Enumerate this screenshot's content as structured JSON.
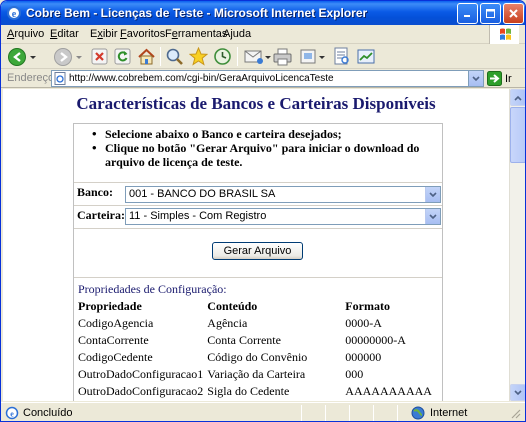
{
  "window": {
    "title": "Cobre Bem - Licenças de Teste - Microsoft Internet Explorer"
  },
  "menu": {
    "items": [
      "Arquivo",
      "Editar",
      "Exibir",
      "Favoritos",
      "Ferramentas",
      "Ajuda"
    ],
    "accels": [
      "A",
      "E",
      "x",
      "F",
      "e",
      "j"
    ]
  },
  "address": {
    "label": "Endereço",
    "url": "http://www.cobrebem.com/cgi-bin/GeraArquivoLicencaTeste",
    "go_label": "Ir"
  },
  "page": {
    "title": "Características de Bancos e Carteiras Disponíveis",
    "instructions": [
      "Selecione abaixo o Banco e carteira desejados;",
      "Clique no botão \"Gerar Arquivo\" para iniciar o download do arquivo de licença de teste."
    ],
    "bank_label": "Banco:",
    "bank_value": "001 - BANCO DO BRASIL SA",
    "wallet_label": "Carteira:",
    "wallet_value": "11 - Simples - Com Registro",
    "generate_button": "Gerar Arquivo",
    "properties_title": "Propriedades de Configuração:",
    "properties_headers": [
      "Propriedade",
      "Conteúdo",
      "Formato"
    ],
    "properties_rows": [
      [
        "CodigoAgencia",
        "Agência",
        "0000-A"
      ],
      [
        "ContaCorrente",
        "Conta Corrente",
        "00000000-A"
      ],
      [
        "CodigoCedente",
        "Código do Convênio",
        "000000"
      ],
      [
        "OutroDadoConfiguracao1",
        "Variação da Carteira",
        "000"
      ],
      [
        "OutroDadoConfiguracao2",
        "Sigla do Cedente",
        "AAAAAAAAAA"
      ]
    ]
  },
  "status": {
    "left": "Concluído",
    "zone": "Internet"
  },
  "colors": {
    "title_bar": "#0A5AE6",
    "page_title": "#1A1A6E",
    "go_arrow": "#2E9F2A"
  }
}
